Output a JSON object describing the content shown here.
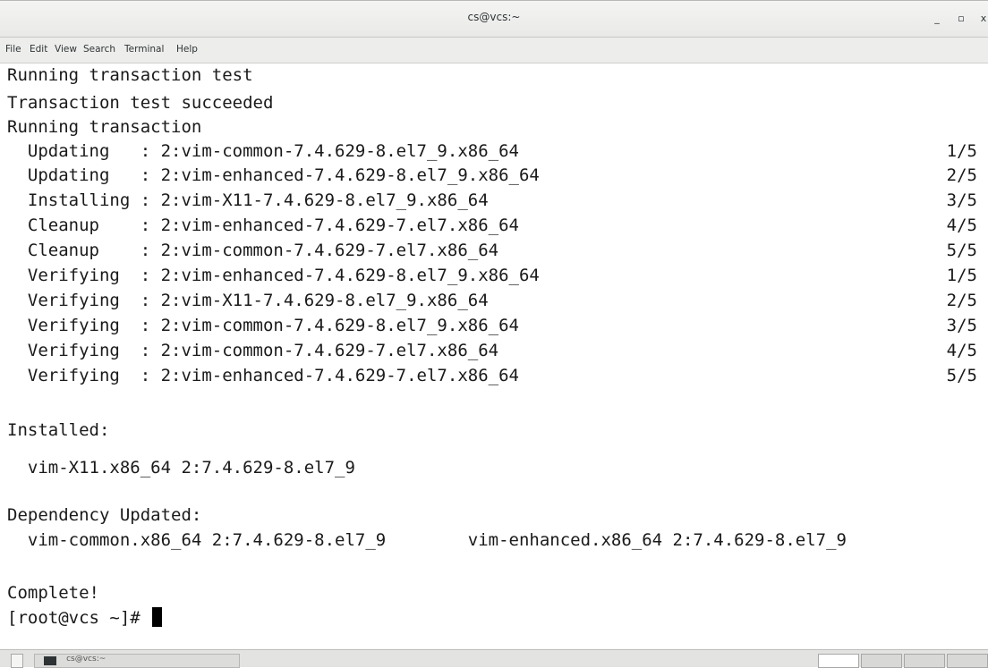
{
  "window": {
    "title": "cs@vcs:~",
    "minimize_glyph": "_",
    "maximize_glyph": "▫",
    "close_glyph": "x"
  },
  "menubar": {
    "items": [
      "File",
      "Edit",
      "View",
      "Search",
      "Terminal",
      "Help"
    ]
  },
  "terminal": {
    "lines": [
      "Running transaction test",
      "Transaction test succeeded",
      "Running transaction",
      "  Updating   : 2:vim-common-7.4.629-8.el7_9.x86_64",
      "  Updating   : 2:vim-enhanced-7.4.629-8.el7_9.x86_64",
      "  Installing : 2:vim-X11-7.4.629-8.el7_9.x86_64",
      "  Cleanup    : 2:vim-enhanced-7.4.629-7.el7.x86_64",
      "  Cleanup    : 2:vim-common-7.4.629-7.el7.x86_64",
      "  Verifying  : 2:vim-enhanced-7.4.629-8.el7_9.x86_64",
      "  Verifying  : 2:vim-X11-7.4.629-8.el7_9.x86_64",
      "  Verifying  : 2:vim-common-7.4.629-8.el7_9.x86_64",
      "  Verifying  : 2:vim-common-7.4.629-7.el7.x86_64",
      "  Verifying  : 2:vim-enhanced-7.4.629-7.el7.x86_64",
      "",
      "Installed:",
      "  vim-X11.x86_64 2:7.4.629-8.el7_9",
      "",
      "Dependency Updated:",
      "  vim-common.x86_64 2:7.4.629-8.el7_9        vim-enhanced.x86_64 2:7.4.629-8.el7_9",
      "",
      "Complete!"
    ],
    "counters": [
      "",
      "",
      "",
      "1/5",
      "2/5",
      "3/5",
      "4/5",
      "5/5",
      "1/5",
      "2/5",
      "3/5",
      "4/5",
      "5/5"
    ],
    "prompt": "[root@vcs ~]# "
  },
  "taskbar": {
    "window_label": "cs@vcs:~"
  }
}
